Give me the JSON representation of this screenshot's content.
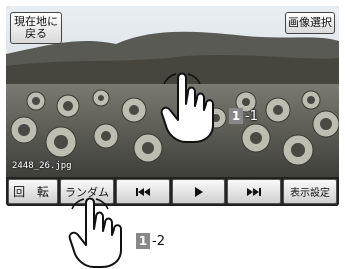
{
  "photo_view": {
    "filename": "2448_26.jpg",
    "top_left_button": "現在地に\n戻る",
    "top_right_button": "画像選択"
  },
  "toolbar": {
    "rotate_label": "回 転",
    "random_label": "ランダム",
    "prev_icon": "skip-previous-icon",
    "play_icon": "play-icon",
    "next_icon": "skip-next-icon",
    "display_settings_label": "表示設定"
  },
  "callouts": {
    "step1_number": "1",
    "step1_suffix": "-1",
    "step2_number": "1",
    "step2_suffix": "-2"
  }
}
